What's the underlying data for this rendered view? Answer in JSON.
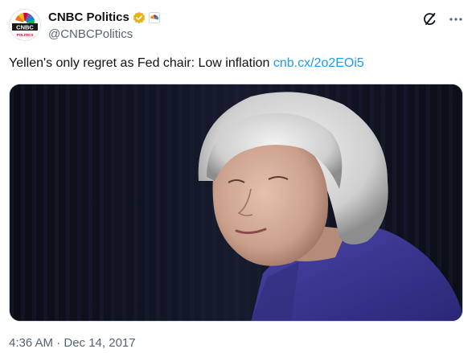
{
  "account": {
    "display_name": "CNBC Politics",
    "handle": "@CNBCPolitics",
    "avatar_text": "CNBC",
    "avatar_subtext": "POLITICS",
    "verified_icon": "gold-checkmark-badge",
    "affiliate_icon": "nbc-peacock-badge"
  },
  "tweet": {
    "text": "Yellen's only regret as Fed chair: Low inflation",
    "link": "cnb.cx/2o2EOi5",
    "timestamp": "4:36 AM · Dec 14, 2017"
  },
  "media": {
    "subject_icon": "portrait-photo"
  },
  "colors": {
    "link": "#1d9bf0",
    "secondary_text": "#536471",
    "verified_gold": "#e8b21c",
    "primary_text": "#0f1419"
  },
  "actions": {
    "grok_icon": "grok-icon",
    "more_icon": "more-dots-icon"
  }
}
